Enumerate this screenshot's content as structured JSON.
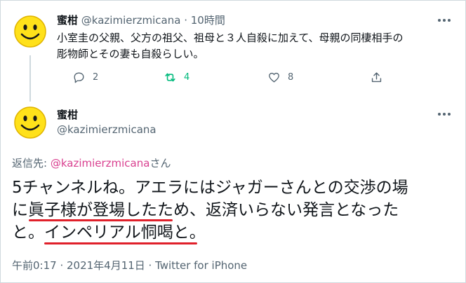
{
  "tweet1": {
    "display_name": "蜜柑",
    "handle": "@kazimierzmicana",
    "separator": " · ",
    "time": "10時間",
    "text_line1": "小室圭の父親、父方の祖父、祖母と３人自殺に加えて、母親の同棲相手の",
    "text_line2": "彫物師とその妻も自殺らしい。",
    "actions": {
      "reply_count": "2",
      "retweet_count": "4",
      "like_count": "8"
    }
  },
  "tweet2": {
    "display_name": "蜜柑",
    "handle": "@kazimierzmicana",
    "reply_prefix": "返信先: ",
    "reply_mention": "@kazimierzmicana",
    "reply_suffix": "さん",
    "text_line1": "5チャンネルね。アエラにはジャガーさんとの交渉の場",
    "text_line2": "に眞子様が登場したため、返済いらない発言となった",
    "text_line3": "と。インペリアル恫喝と。",
    "timestamp": "午前0:17 · 2021年4月11日 · Twitter for iPhone"
  },
  "colors": {
    "text": "#0f1419",
    "muted": "#536471",
    "retweet_active": "#00ba7c",
    "mention": "#d93f8f",
    "annotation_underline": "#e0202a"
  },
  "icons": {
    "avatar": "smiley-face",
    "more": "more-dots-icon",
    "reply": "reply-bubble-icon",
    "retweet": "retweet-icon",
    "like": "heart-icon",
    "share": "share-icon"
  }
}
